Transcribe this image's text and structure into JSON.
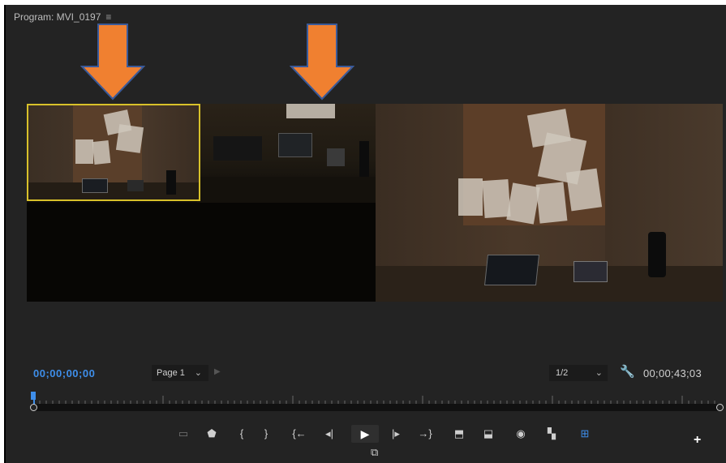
{
  "panel": {
    "title": "Program: MVI_0197",
    "menu_icon": "hamburger-menu-icon"
  },
  "timecode_current": "00;00;00;00",
  "page_selector": {
    "value": "Page 1",
    "chevron": "⌄"
  },
  "resolution_selector": {
    "value": "1/2",
    "chevron": "⌄"
  },
  "timecode_duration": "00;00;43;03",
  "colors": {
    "accent": "#3e8eea",
    "inset_border": "#d8c12a",
    "arrow_fill": "#f08030",
    "arrow_stroke": "#3a5a9a",
    "panel_bg": "#232323"
  },
  "transport": {
    "buttons": [
      {
        "name": "safe-margins-icon",
        "glyph": "▭"
      },
      {
        "name": "add-marker-icon",
        "glyph": "⬟"
      },
      {
        "name": "mark-in-icon",
        "glyph": "{"
      },
      {
        "name": "mark-out-icon",
        "glyph": "}"
      },
      {
        "name": "go-to-in-icon",
        "glyph": "{←"
      },
      {
        "name": "step-back-icon",
        "glyph": "◂|"
      },
      {
        "name": "play-icon",
        "glyph": "▶"
      },
      {
        "name": "step-forward-icon",
        "glyph": "|▸"
      },
      {
        "name": "go-to-out-icon",
        "glyph": "→}"
      },
      {
        "name": "lift-icon",
        "glyph": "⬒"
      },
      {
        "name": "extract-icon",
        "glyph": "⬓"
      },
      {
        "name": "export-frame-icon",
        "glyph": "◉"
      },
      {
        "name": "comparison-view-icon",
        "glyph": "▚"
      },
      {
        "name": "multi-camera-icon",
        "glyph": "⊞"
      }
    ],
    "below_button": {
      "name": "toggle-proxies-icon",
      "glyph": "⧉"
    }
  },
  "plus_icon": "+"
}
